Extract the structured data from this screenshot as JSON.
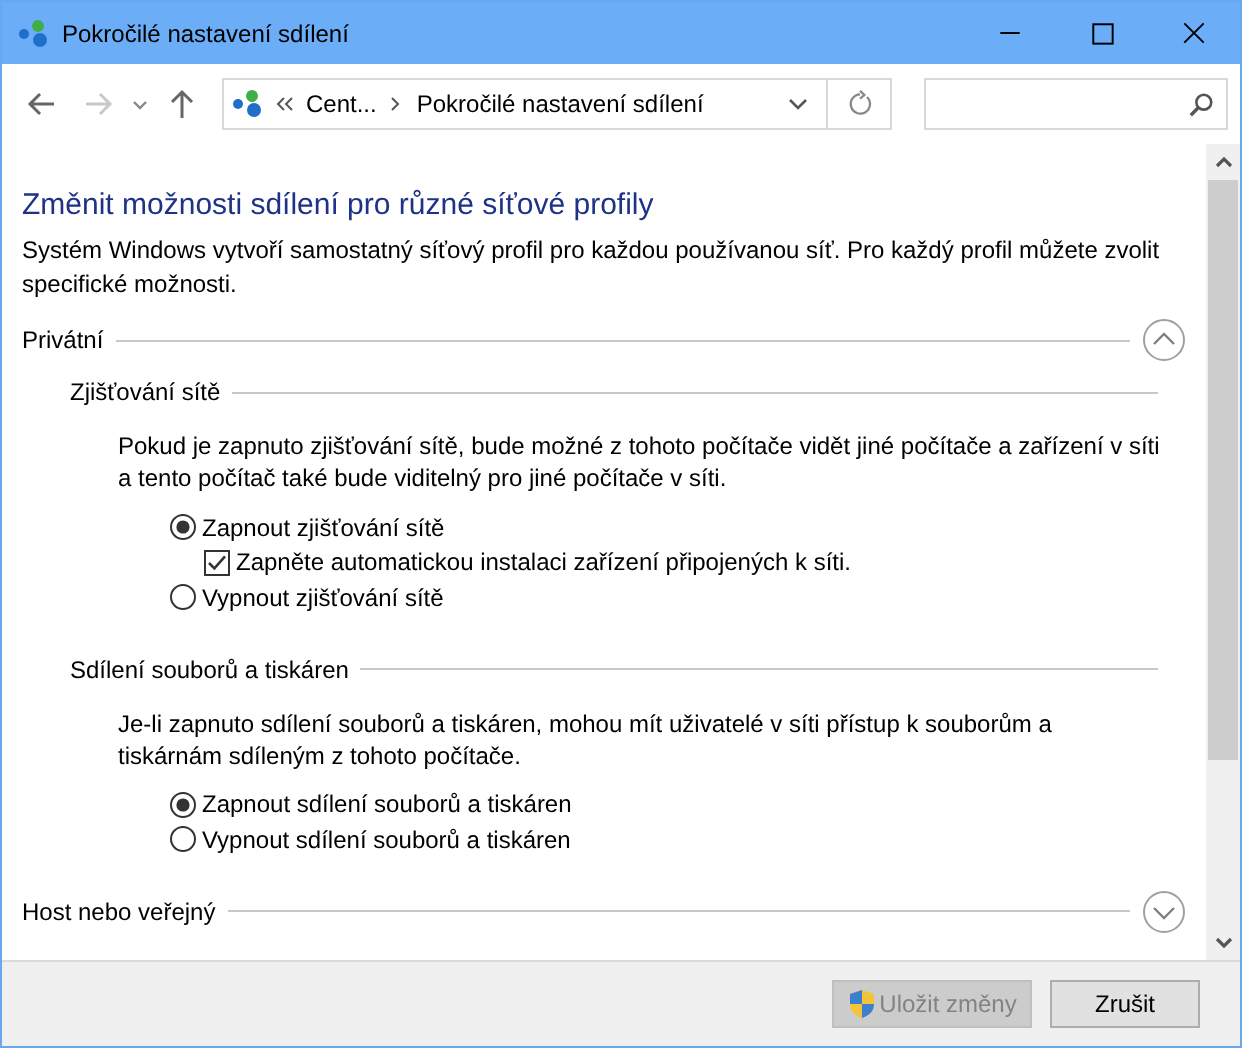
{
  "window": {
    "title": "Pokročilé nastavení sdílení"
  },
  "nav": {
    "back_disabled": false,
    "forward_disabled": true
  },
  "address": {
    "crumbs": [
      "Cent...",
      "Pokročilé nastavení sdílení"
    ]
  },
  "heading": "Změnit možnosti sdílení pro různé síťové profily",
  "description": "Systém Windows vytvoří samostatný síťový profil pro každou používanou síť. Pro každý profil můžete zvolit specifické možnosti.",
  "profiles": [
    {
      "name": "Privátní",
      "expanded": true,
      "sections": [
        {
          "title": "Zjišťování sítě",
          "description": "Pokud je zapnuto zjišťování sítě, bude možné z tohoto počítače vidět jiné počítače a zařízení v síti a tento počítač také bude viditelný pro jiné počítače v síti.",
          "options": [
            {
              "kind": "radio",
              "label": "Zapnout zjišťování sítě",
              "selected": true
            },
            {
              "kind": "checkbox",
              "label": "Zapněte automatickou instalaci zařízení připojených k síti.",
              "checked": true
            },
            {
              "kind": "radio",
              "label": "Vypnout zjišťování sítě",
              "selected": false
            }
          ]
        },
        {
          "title": "Sdílení souborů a tiskáren",
          "description": "Je-li zapnuto sdílení souborů a tiskáren, mohou mít uživatelé v síti přístup k souborům a tiskárnám sdíleným z tohoto počítače.",
          "options": [
            {
              "kind": "radio",
              "label": "Zapnout sdílení souborů a tiskáren",
              "selected": true
            },
            {
              "kind": "radio",
              "label": "Vypnout sdílení souborů a tiskáren",
              "selected": false
            }
          ]
        }
      ]
    },
    {
      "name": "Host nebo veřejný",
      "expanded": false
    }
  ],
  "buttons": [
    {
      "label": "Uložit změny",
      "disabled": true,
      "shield": true
    },
    {
      "label": "Zrušit",
      "disabled": false,
      "shield": false
    }
  ]
}
